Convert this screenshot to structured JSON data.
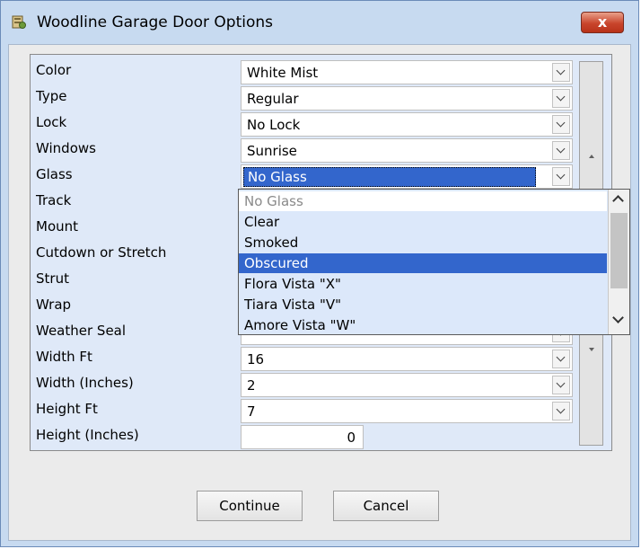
{
  "window": {
    "title": "Woodline Garage Door Options",
    "close_label": "x"
  },
  "options": [
    {
      "label": "Color",
      "value": "White Mist",
      "kind": "select"
    },
    {
      "label": "Type",
      "value": "Regular",
      "kind": "select"
    },
    {
      "label": "Lock",
      "value": "No Lock",
      "kind": "select"
    },
    {
      "label": "Windows",
      "value": "Sunrise",
      "kind": "select"
    },
    {
      "label": "Glass",
      "value": "No Glass",
      "kind": "select",
      "selected": true
    },
    {
      "label": "Track",
      "value": "",
      "kind": "select"
    },
    {
      "label": "Mount",
      "value": "",
      "kind": "select"
    },
    {
      "label": "Cutdown or Stretch",
      "value": "",
      "kind": "select"
    },
    {
      "label": "Strut",
      "value": "",
      "kind": "select"
    },
    {
      "label": "Wrap",
      "value": "",
      "kind": "select"
    },
    {
      "label": "Weather Seal",
      "value": "",
      "kind": "select"
    },
    {
      "label": "Width Ft",
      "value": "16",
      "kind": "select"
    },
    {
      "label": "Width (Inches)",
      "value": "2",
      "kind": "select"
    },
    {
      "label": "Height Ft",
      "value": "7",
      "kind": "select"
    },
    {
      "label": "Height (Inches)",
      "value": "0",
      "kind": "number"
    }
  ],
  "glass_dropdown": {
    "items": [
      "No Glass",
      "Clear",
      "Smoked",
      "Obscured",
      "Flora Vista \"X\"",
      "Tiara Vista \"V\"",
      "Amore Vista \"W\""
    ],
    "highlighted": "Obscured"
  },
  "buttons": {
    "continue_label": "Continue",
    "cancel_label": "Cancel"
  },
  "colors": {
    "title_bar": "#c7daf0",
    "selection": "#3366cc",
    "close_button": "#c9452c",
    "grid_background": "#dfe9f8"
  }
}
